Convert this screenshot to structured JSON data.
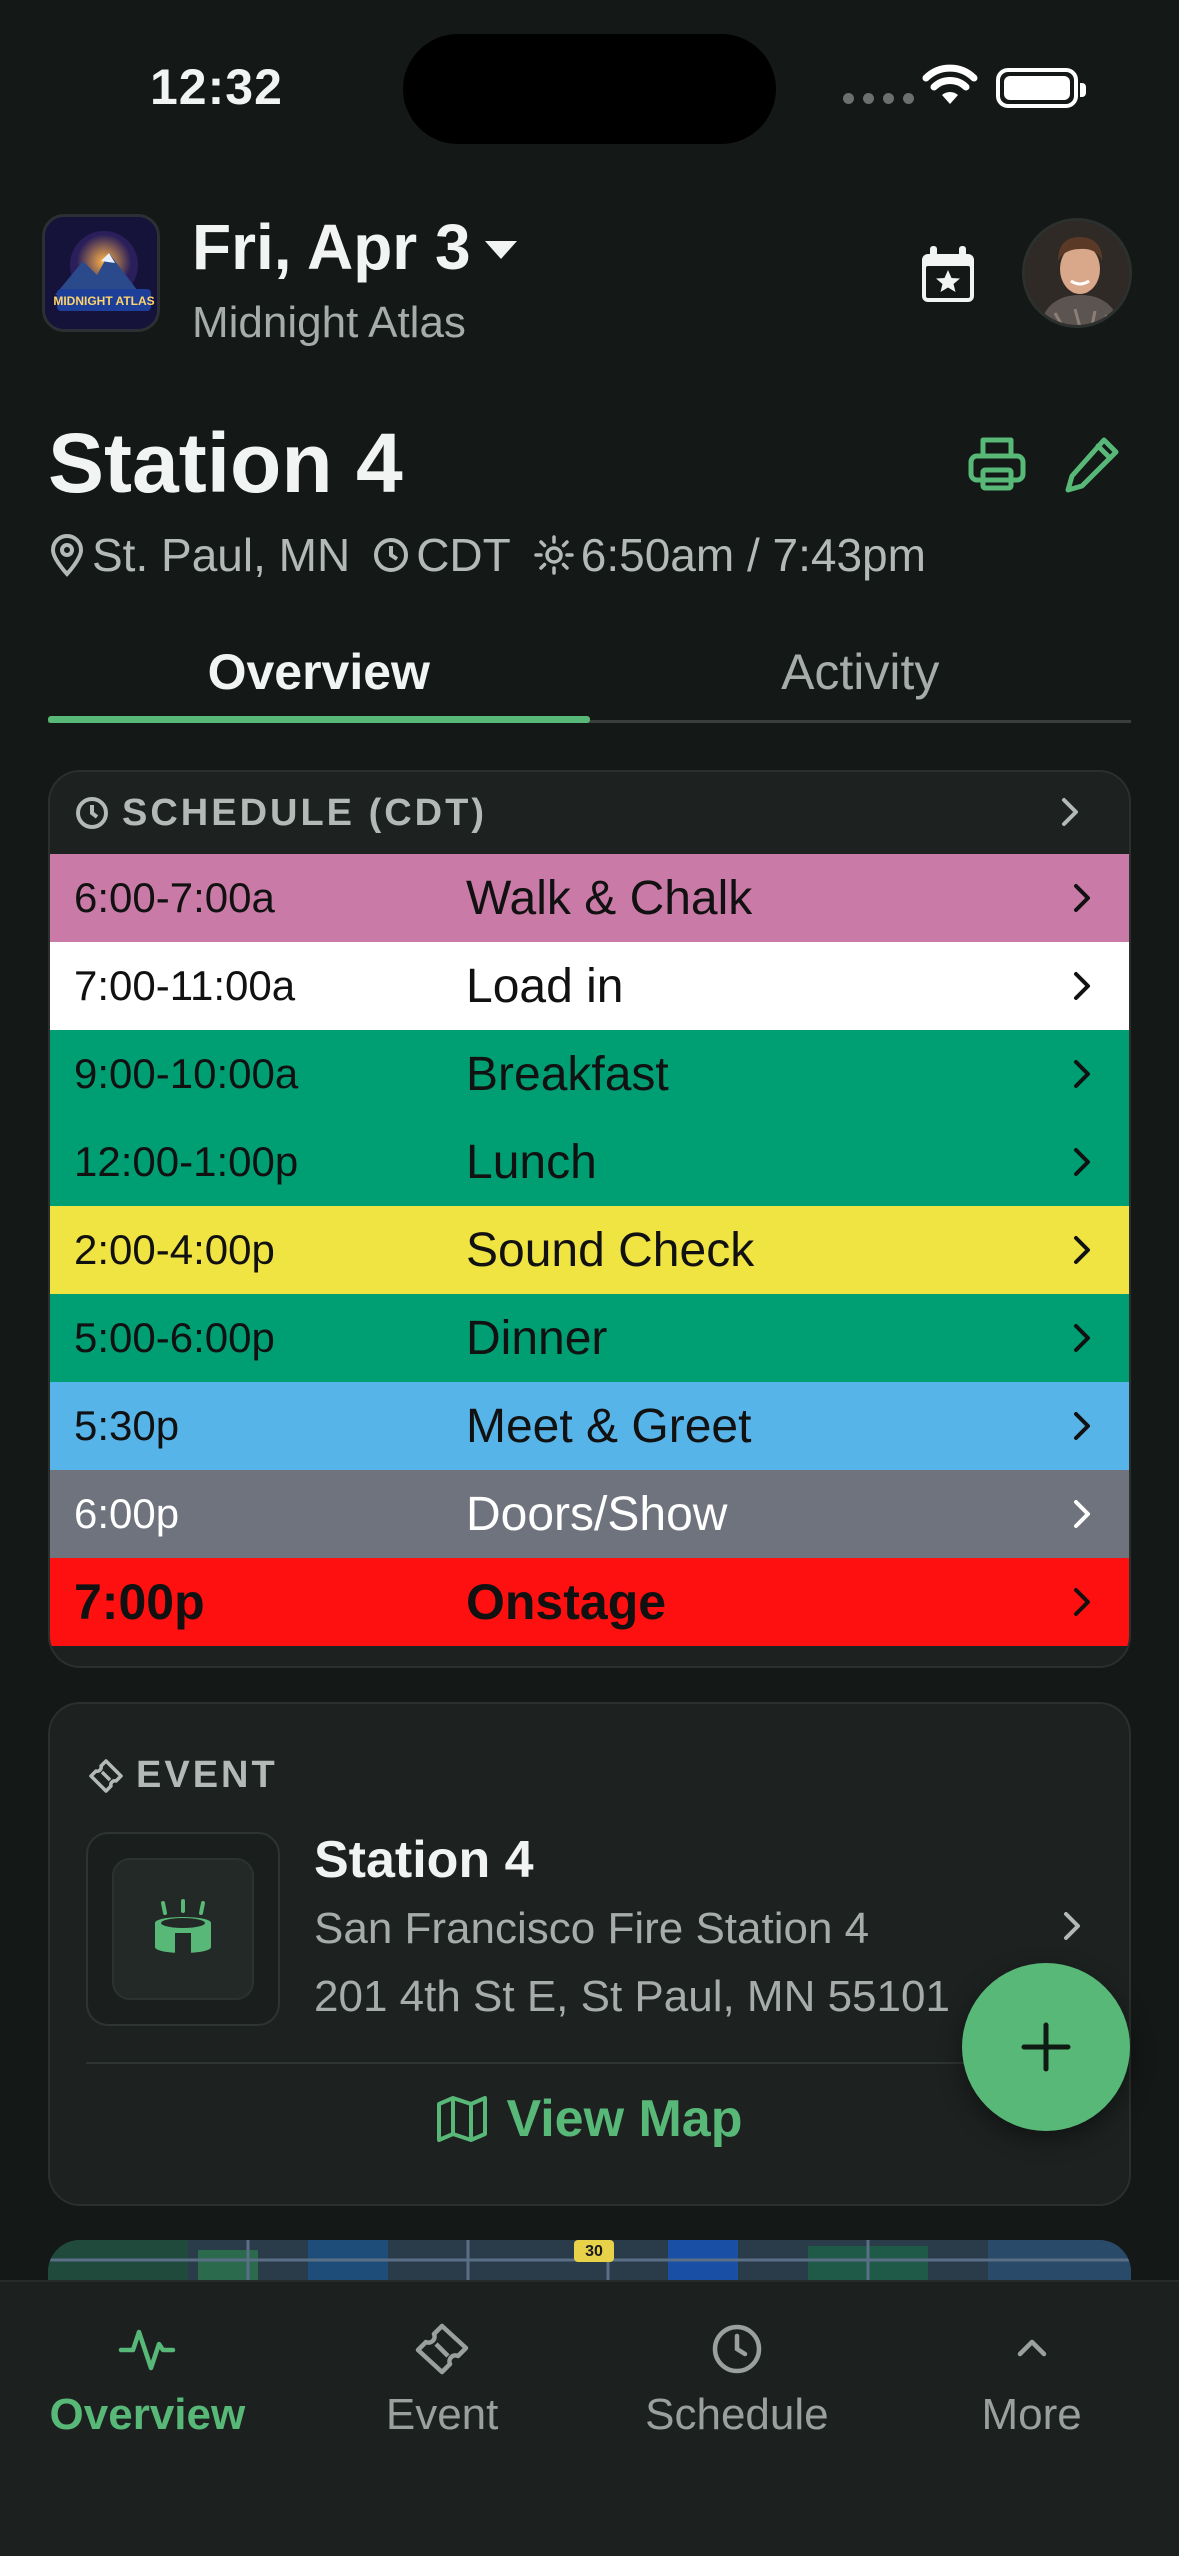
{
  "status_bar": {
    "time": "12:32"
  },
  "header": {
    "date": "Fri, Apr 3",
    "workspace": "Midnight Atlas",
    "logo_text": "MIDNIGHT ATLAS"
  },
  "venue": {
    "title": "Station 4",
    "location": "St. Paul, MN",
    "timezone": "CDT",
    "sun": "6:50am / 7:43pm"
  },
  "tabs": [
    {
      "label": "Overview",
      "active": true
    },
    {
      "label": "Activity",
      "active": false
    }
  ],
  "schedule": {
    "header": "SCHEDULE (CDT)",
    "items": [
      {
        "time": "6:00-7:00a",
        "label": "Walk & Chalk",
        "color": "#c97aa6",
        "text": "#111111",
        "bold": false
      },
      {
        "time": "7:00-11:00a",
        "label": "Load in",
        "color": "#ffffff",
        "text": "#111111",
        "bold": false
      },
      {
        "time": "9:00-10:00a",
        "label": "Breakfast",
        "color": "#009e73",
        "text": "#111111",
        "bold": false
      },
      {
        "time": "12:00-1:00p",
        "label": "Lunch",
        "color": "#009e73",
        "text": "#111111",
        "bold": false
      },
      {
        "time": "2:00-4:00p",
        "label": "Sound Check",
        "color": "#f0e442",
        "text": "#111111",
        "bold": false
      },
      {
        "time": "5:00-6:00p",
        "label": "Dinner",
        "color": "#009e73",
        "text": "#111111",
        "bold": false
      },
      {
        "time": "5:30p",
        "label": "Meet & Greet",
        "color": "#56b4e9",
        "text": "#111111",
        "bold": false
      },
      {
        "time": "6:00p",
        "label": "Doors/Show",
        "color": "#6e737d",
        "text": "#ffffff",
        "bold": false
      },
      {
        "time": "7:00p",
        "label": "Onstage",
        "color": "#ff1010",
        "text": "#111111",
        "bold": true
      }
    ]
  },
  "event": {
    "header": "EVENT",
    "name": "Station 4",
    "place": "San Francisco Fire Station 4",
    "address": "201 4th St E, St Paul, MN 55101",
    "view_map_label": "View Map"
  },
  "map": {
    "route_label": "30"
  },
  "bottom_nav": [
    {
      "label": "Overview",
      "icon": "activity-icon",
      "active": true
    },
    {
      "label": "Event",
      "icon": "ticket-icon",
      "active": false
    },
    {
      "label": "Schedule",
      "icon": "clock-icon",
      "active": false
    },
    {
      "label": "More",
      "icon": "chevron-up-icon",
      "active": false
    }
  ],
  "colors": {
    "accent": "#58b878",
    "background": "#141816",
    "card": "#1d2220"
  }
}
